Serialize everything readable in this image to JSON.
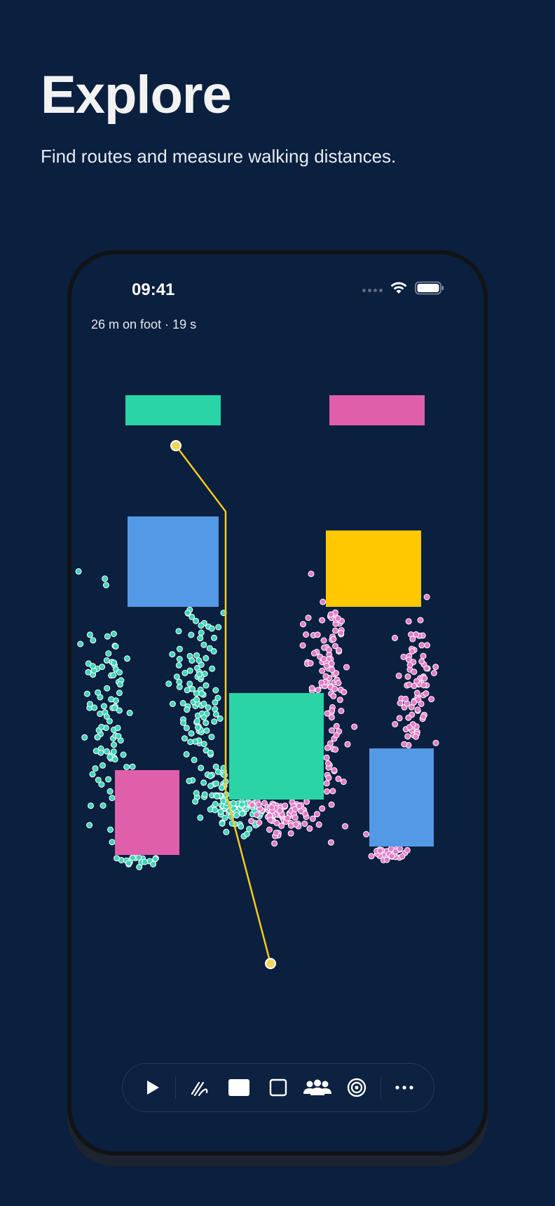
{
  "page": {
    "title": "Explore",
    "subtitle": "Find routes and measure walking distances."
  },
  "status_bar": {
    "time": "09:41"
  },
  "route": {
    "info": "26 m on foot · 19 s",
    "color": "#f5cc1e"
  },
  "map": {
    "background": "#0b1f3f",
    "colors": {
      "green": "#2ad4a6",
      "pink": "#e05fab",
      "blue": "#5499e6",
      "yellow": "#ffc800",
      "green_dot": "#3fd6b8",
      "pink_dot": "#e57cc8"
    }
  },
  "toolbar": {
    "tools": [
      {
        "name": "play-icon"
      },
      {
        "name": "draw-icon"
      },
      {
        "name": "filled-rect-icon"
      },
      {
        "name": "outline-rect-icon"
      },
      {
        "name": "people-icon"
      },
      {
        "name": "target-icon"
      },
      {
        "name": "more-icon"
      }
    ]
  }
}
